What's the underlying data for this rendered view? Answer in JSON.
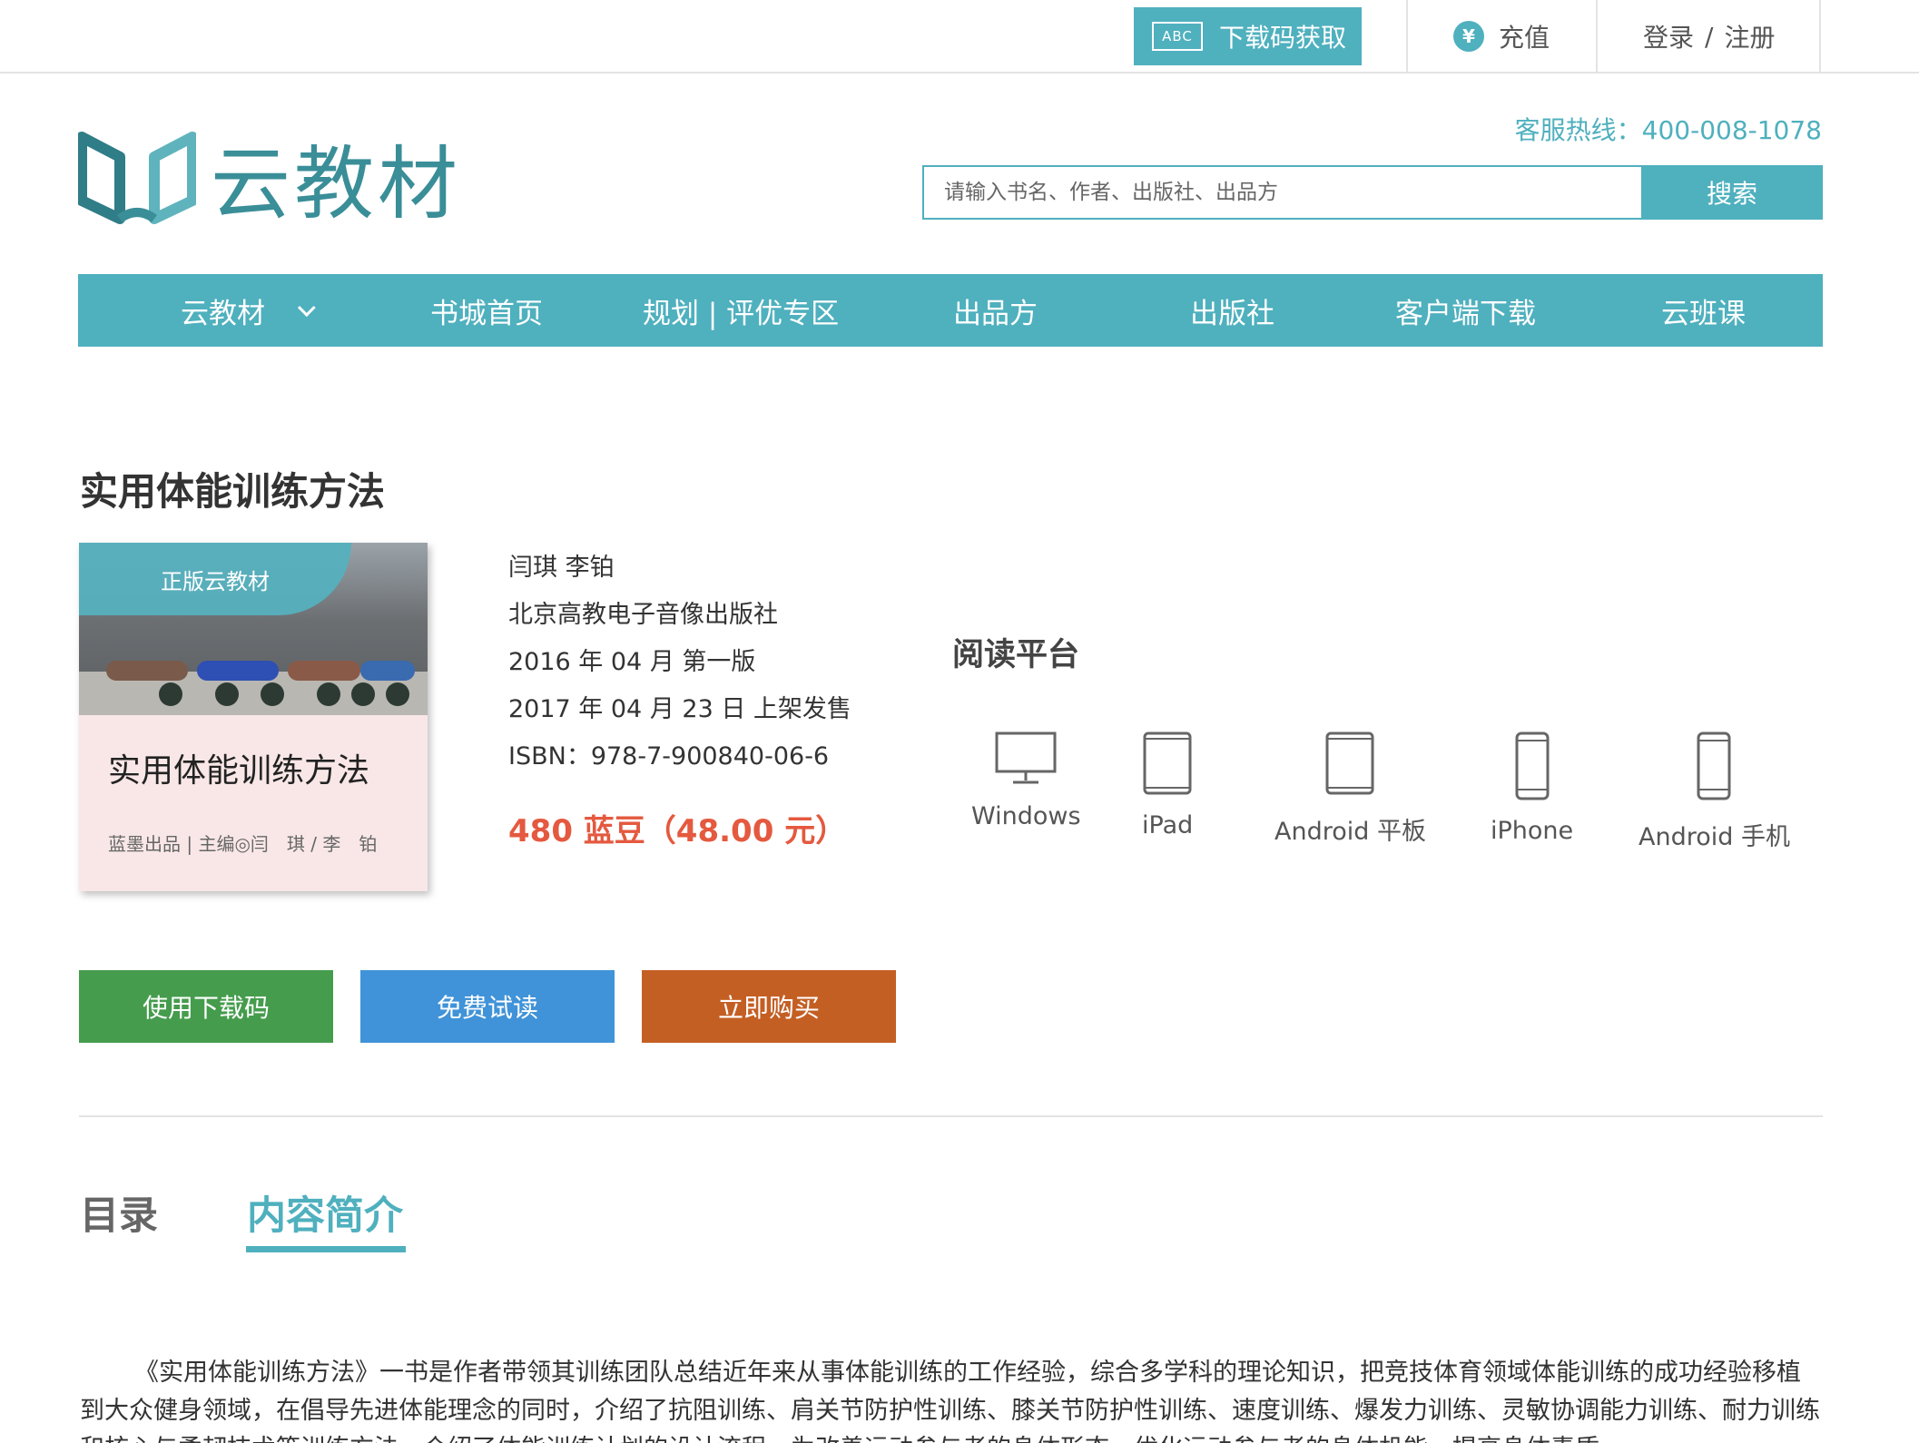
{
  "topbar": {
    "download_code": {
      "icon_text": "ABC",
      "label": "下载码获取"
    },
    "recharge": {
      "icon": "yen-icon",
      "icon_text": "¥",
      "label": "充值"
    },
    "login": {
      "login": "登录",
      "slash": "/",
      "register": "注册"
    }
  },
  "header": {
    "logo_text": "云教材",
    "hotline": "客服热线：400-008-1078",
    "search": {
      "placeholder": "请输入书名、作者、出版社、出品方",
      "value": "",
      "button": "搜索"
    }
  },
  "nav": {
    "items": [
      {
        "label": "云教材"
      },
      {
        "label": "书城首页"
      },
      {
        "label": "规划 | 评优专区"
      },
      {
        "label": "出品方"
      },
      {
        "label": "出版社"
      },
      {
        "label": "客户端下载"
      },
      {
        "label": "云班课"
      }
    ]
  },
  "book": {
    "title": "实用体能训练方法",
    "cover": {
      "ribbon": "正版云教材",
      "title": "实用体能训练方法",
      "meta": "蓝墨出品  |  主编◎闫　琪 / 李　铂"
    },
    "authors": "闫琪 李铂",
    "publisher": "北京高教电子音像出版社",
    "edition": "2016 年 04 月 第一版",
    "release": "2017 年 04 月 23 日 上架发售",
    "isbn": "ISBN：978-7-900840-06-6",
    "price": "480 蓝豆（48.00 元）"
  },
  "platforms": {
    "title": "阅读平台",
    "items": [
      {
        "label": "Windows",
        "icon": "monitor-icon"
      },
      {
        "label": "iPad",
        "icon": "tablet-icon"
      },
      {
        "label": "Android 平板",
        "icon": "tablet-icon"
      },
      {
        "label": "iPhone",
        "icon": "phone-icon"
      },
      {
        "label": "Android 手机",
        "icon": "phone-icon"
      }
    ]
  },
  "actions": {
    "use_code": "使用下载码",
    "free_trial": "免费试读",
    "buy_now": "立即购买"
  },
  "tabs": {
    "toc": "目录",
    "intro": "内容简介",
    "active": "intro"
  },
  "intro_text": "《实用体能训练方法》一书是作者带领其训练团队总结近年来从事体能训练的工作经验，综合多学科的理论知识，把竞技体育领域体能训练的成功经验移植到大众健身领域，在倡导先进体能理念的同时，介绍了抗阻训练、肩关节防护性训练、膝关节防护性训练、速度训练、爆发力训练、灵敏协调能力训练、耐力训练和核心与柔韧技术等训练方法，介绍了体能训练计划的设计流程，为改善运动参与者的身体形态、优化运动参与者的身体机能、提高身体素质",
  "colors": {
    "accent": "#4fb0be",
    "logo": "#3a8e98",
    "price": "#e4593f",
    "btn_green": "#459c4d",
    "btn_blue": "#4093d8",
    "btn_orange": "#c45f24"
  }
}
